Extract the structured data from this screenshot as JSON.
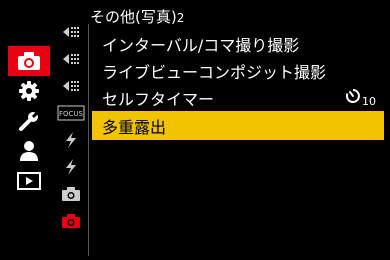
{
  "header": {
    "title": "その他(写真)",
    "page": "2"
  },
  "main_tabs": [
    {
      "icon": "camera-icon",
      "active": true
    },
    {
      "icon": "gear-icon",
      "active": false
    },
    {
      "icon": "wrench-icon",
      "active": false
    },
    {
      "icon": "person-icon",
      "active": false
    },
    {
      "icon": "play-icon",
      "active": false
    }
  ],
  "sub_tabs": [
    {
      "icon": "photo-style-icon"
    },
    {
      "icon": "photo-style-icon"
    },
    {
      "icon": "photo-style-icon"
    },
    {
      "icon": "focus-icon",
      "label": "FOCUS"
    },
    {
      "icon": "flash-icon"
    },
    {
      "icon": "flash-icon"
    },
    {
      "icon": "camera-small-icon"
    },
    {
      "icon": "camera-small-icon",
      "active": true
    }
  ],
  "menu": {
    "items": [
      {
        "label": "インターバル/コマ撮り撮影"
      },
      {
        "label": "ライブビューコンポジット撮影"
      },
      {
        "label": "セルフタイマー",
        "value": "10"
      },
      {
        "label": "多重露出",
        "selected": true
      }
    ]
  },
  "colors": {
    "accent_red": "#e60012",
    "highlight_yellow": "#f2c400"
  }
}
